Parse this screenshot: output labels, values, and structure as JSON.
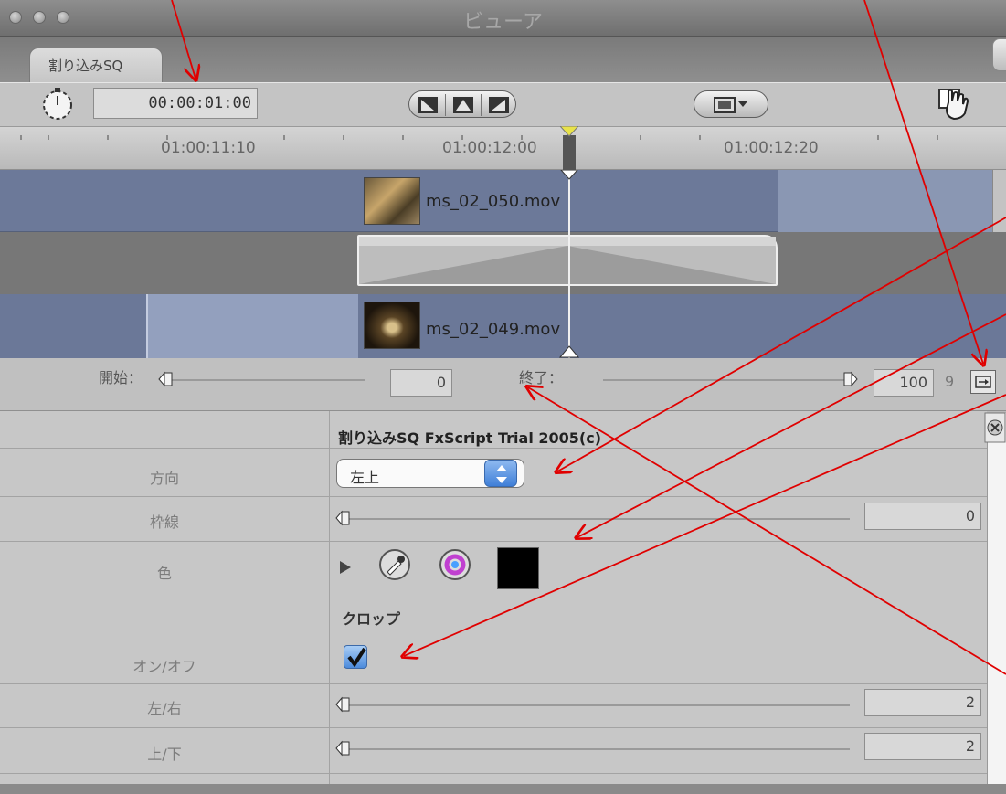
{
  "window": {
    "title": "ビューア"
  },
  "tab": {
    "label": "割り込みSQ"
  },
  "toolbar": {
    "timecode": "00:00:01:00"
  },
  "ruler": {
    "labels": [
      "01:00:11:10",
      "01:00:12:00",
      "01:00:12:20"
    ]
  },
  "clips": {
    "outgoing": {
      "name": "ms_02_050.mov"
    },
    "incoming": {
      "name": "ms_02_049.mov"
    }
  },
  "range": {
    "start_label": "開始：",
    "start_value": "0",
    "end_label": "終了：",
    "end_value": "100",
    "end_suffix": "9"
  },
  "params": {
    "header": "割り込みSQ  FxScript Trial 2005(c)",
    "direction": {
      "label": "方向",
      "value": "左上"
    },
    "border": {
      "label": "枠線",
      "value": "0"
    },
    "color": {
      "label": "色",
      "swatch": "#000000"
    },
    "crop_section": "クロップ",
    "crop_onoff": {
      "label": "オン/オフ",
      "checked": true
    },
    "left_right": {
      "label": "左/右",
      "value": "2"
    },
    "top_bottom": {
      "label": "上/下",
      "value": "2"
    }
  },
  "colors": {
    "annotation_arrow": "#e00000",
    "clip_blue": "#6c7999"
  }
}
